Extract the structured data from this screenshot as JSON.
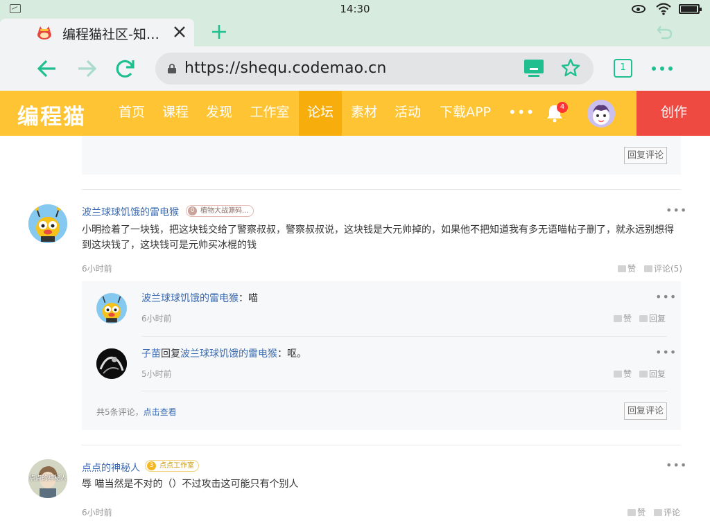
{
  "statusbar": {
    "time": "14:30"
  },
  "browser": {
    "tab_title": "编程猫社区-知…",
    "url": "https://sheq​u.codemao.cn",
    "tab_count": "1",
    "colors": {
      "accent": "#1fbf8f",
      "status_bg": "#d7ecdf"
    }
  },
  "site": {
    "logo": "编程猫",
    "nav": [
      "首页",
      "课程",
      "发现",
      "工作室",
      "论坛",
      "素材",
      "活动",
      "下载APP"
    ],
    "active_nav": "论坛",
    "more": "•••",
    "notification_count": "4",
    "create_label": "创作",
    "colors": {
      "nav_bg": "#fec433",
      "nav_active": "#f7ad0b",
      "create_bg": "#ef4a42"
    }
  },
  "thread": {
    "top_reply_button": "回复评论",
    "posts": [
      {
        "user": "波兰球球饥饿的雷电猴",
        "badge_level": "0",
        "badge_text": "植物大战源码...",
        "content": "小明捡着了一块钱，把这块钱交给了警察叔叔，警察叔叔说，这块钱是大元帅掉的，如果他不把知道我有多无语喵帖子删了，就永远别想得到这块钱了，这块钱可是元帅买冰棍的钱",
        "time": "6小时前",
        "like_label": "赞",
        "comment_label": "评论(5)",
        "replies": [
          {
            "user": "波兰球球饥饿的雷电猴",
            "sep": "：",
            "content": "喵",
            "time": "6小时前",
            "like_label": "赞",
            "reply_label": "回复"
          },
          {
            "user": "子苗",
            "reply_word": "回复",
            "target": "波兰球球饥饿的雷电猴",
            "sep": "：",
            "content": "呕。",
            "time": "5小时前",
            "like_label": "赞",
            "reply_label": "回复"
          }
        ],
        "total_text": "共5条评论，",
        "view_link": "点击查看",
        "reply_button": "回复评论"
      },
      {
        "user": "点点的神秘人",
        "badge_level": "3",
        "badge_text": "点点工作室",
        "avatar_text": "点点的神秘人",
        "content": "辱 喵当然是不对的（）不过攻击这可能只有个别人",
        "time": "6小时前",
        "like_label": "赞",
        "comment_label": "评论"
      }
    ]
  }
}
